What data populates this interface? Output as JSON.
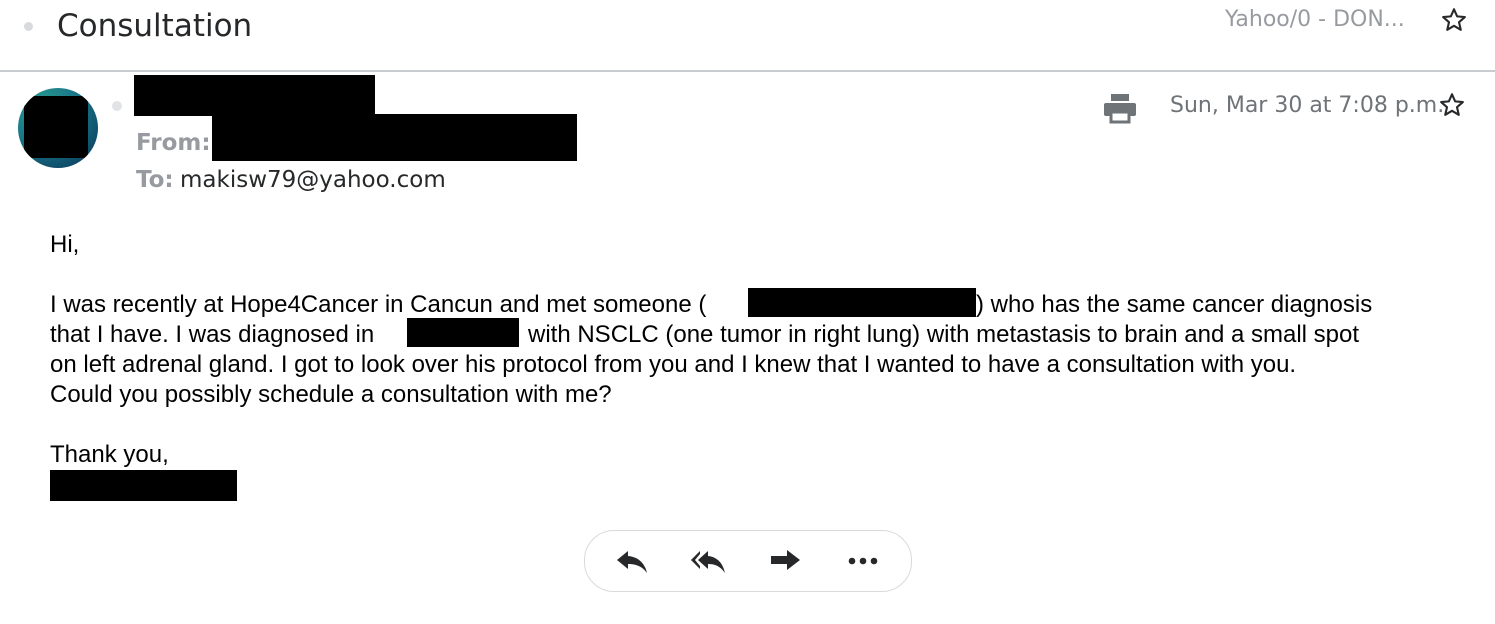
{
  "header": {
    "subject": "Consultation",
    "folder": "Yahoo/0 - DON..."
  },
  "message": {
    "from_label": "From:",
    "to_label": "To:",
    "to_value": "makisw79@yahoo.com",
    "date": "Sun, Mar 30 at 7:08 p.m."
  },
  "body": {
    "greeting": "Hi,",
    "p1_l1_a": "I was recently at Hope4Cancer in Cancun and met someone (",
    "p1_l1_b": ") who has the same cancer diagnosis",
    "p1_l2_a": "that I have.  I was diagnosed in",
    "p1_l2_b": "with NSCLC (one tumor in right lung) with metastasis to brain and a small spot",
    "p1_l3": "on left adrenal gland. I got to look over his protocol from you and I knew that I wanted to have a consultation with you.",
    "p1_l4": "Could you possibly schedule a consultation with me?",
    "closing": "Thank you,"
  },
  "actions": {
    "icons": [
      "reply-icon",
      "reply-all-icon",
      "forward-icon",
      "more-icon"
    ]
  },
  "colors": {
    "muted_text": "#979ba0",
    "divider": "#c9ccd1",
    "redaction": "#000000",
    "icon": "#26282a"
  }
}
